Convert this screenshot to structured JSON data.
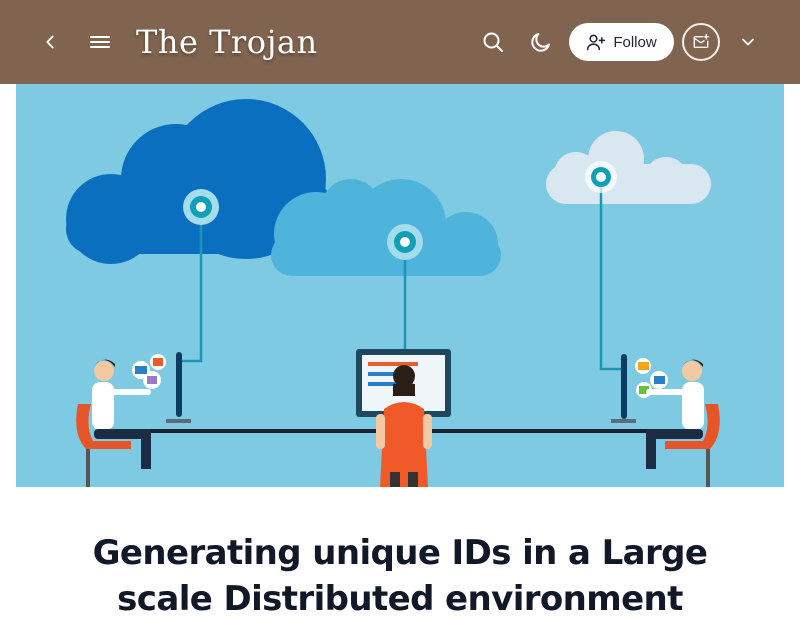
{
  "header": {
    "blog_title": "The Trojan",
    "follow_label": "Follow",
    "icons": [
      "chevron-left-icon",
      "hamburger-menu-icon",
      "search-icon",
      "moon-icon",
      "user-plus-icon",
      "newsletter-mail-icon",
      "chevron-down-icon"
    ]
  },
  "colors": {
    "header_background": "#81644f",
    "cover_background": "#7ecae3",
    "title_text": "#111827"
  },
  "article": {
    "cover_alt": "Illustration of people at computers connected to clouds",
    "title": "Generating unique IDs in a Large scale Distributed environment"
  }
}
